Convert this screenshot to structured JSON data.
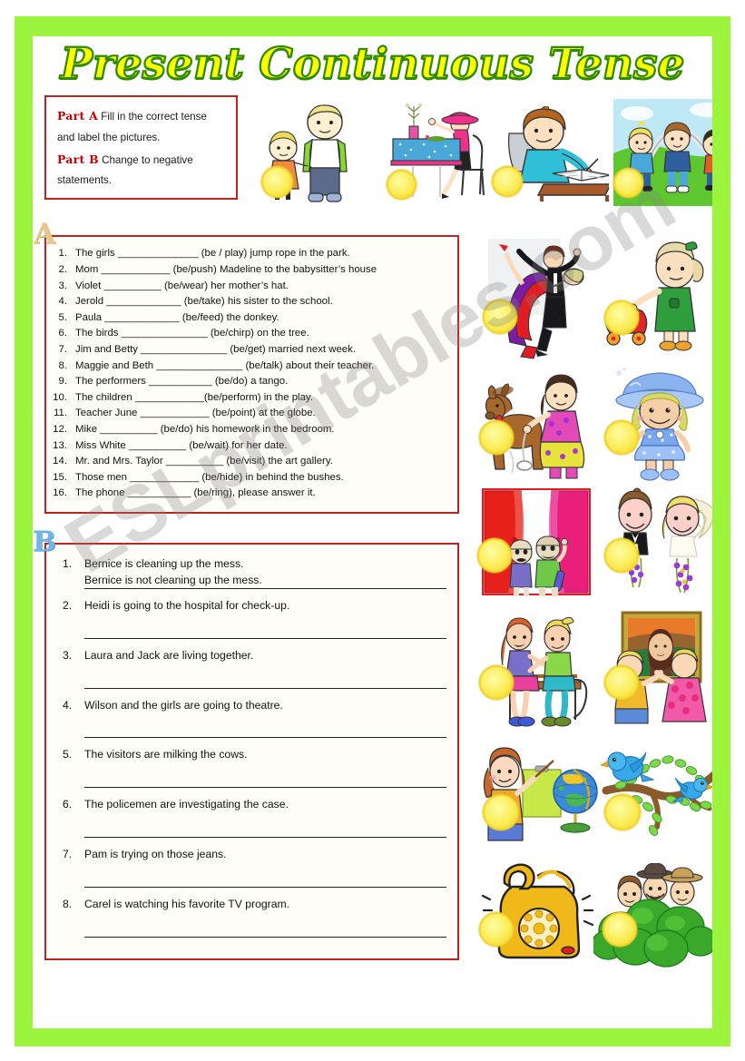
{
  "title": "Present Continuous Tense",
  "watermark": "ESLprintables.com",
  "colors": {
    "frame_green": "#9cf53c",
    "title_yellow": "#ffff00",
    "title_outline_green": "#2e8b00",
    "box_red": "#c0231f",
    "part_label_red": "#cc0000",
    "coin_yellow": "#fbed57"
  },
  "instructions": {
    "part_a_label": "Part A",
    "part_a_text": "Fill in the correct tense and label the pictures.",
    "part_b_label": "Part B",
    "part_b_text": "Change to negative statements."
  },
  "section_a": {
    "badge": "A",
    "items": [
      {
        "num": "1.",
        "text": "The girls ______________ (be / play) jump rope in the park."
      },
      {
        "num": "2.",
        "text": "Mom ____________ (be/push) Madeline to the babysitter’s house"
      },
      {
        "num": "3.",
        "text": "Violet __________ (be/wear) her mother’s hat."
      },
      {
        "num": "4.",
        "text": "Jerold _____________ (be/take) his sister to the school."
      },
      {
        "num": "5.",
        "text": "Paula _____________ (be/feed) the donkey."
      },
      {
        "num": "6.",
        "text": "The birds _______________ (be/chirp) on the tree."
      },
      {
        "num": "7.",
        "text": "Jim and Betty _______________ (be/get) married next week."
      },
      {
        "num": "8.",
        "text": "Maggie and Beth _______________ (be/talk) about their teacher."
      },
      {
        "num": "9.",
        "text": "The performers ___________ (be/do) a tango."
      },
      {
        "num": "10.",
        "text": "The children ____________(be/perform) in the play."
      },
      {
        "num": "11.",
        "text": "Teacher June ____________ (be/point) at the globe."
      },
      {
        "num": "12.",
        "text": "Mike __________ (be/do) his homework in the bedroom."
      },
      {
        "num": "13.",
        "text": "Miss White __________ (be/wait) for her date."
      },
      {
        "num": "14.",
        "text": "Mr. and Mrs. Taylor __________ (be/visit) the art gallery."
      },
      {
        "num": "15.",
        "text": "Those men ____________ (be/hide) in behind the bushes."
      },
      {
        "num": "16.",
        "text": "The phone ___________ (be/ring), please answer it."
      }
    ]
  },
  "section_b": {
    "badge": "B",
    "items": [
      {
        "num": "1.",
        "prompt": "Bernice is cleaning up the mess.",
        "answer": "Bernice is not cleaning up the mess."
      },
      {
        "num": "2.",
        "prompt": "Heidi is going to the hospital for check-up.",
        "answer": ""
      },
      {
        "num": "3.",
        "prompt": "Laura and Jack are living together.",
        "answer": ""
      },
      {
        "num": "4.",
        "prompt": "Wilson and the girls are going to theatre.",
        "answer": ""
      },
      {
        "num": "5.",
        "prompt": "The visitors are milking the cows.",
        "answer": ""
      },
      {
        "num": "6.",
        "prompt": "The policemen are investigating the case.",
        "answer": ""
      },
      {
        "num": "7.",
        "prompt": "Pam is trying on those jeans.",
        "answer": ""
      },
      {
        "num": "8.",
        "prompt": "Carel is watching his favorite TV program.",
        "answer": ""
      }
    ]
  },
  "pictures": {
    "top": [
      {
        "name": "children-holding-hands",
        "label": "two children holding hands"
      },
      {
        "name": "woman-in-pink-hat-at-table",
        "label": "woman wearing a pink hat at a table"
      },
      {
        "name": "boy-writing-at-desk",
        "label": "boy writing in a book at a desk"
      },
      {
        "name": "children-jumping-rope",
        "label": "children jumping rope in the park"
      }
    ],
    "right": [
      {
        "name": "tango-dancers",
        "label": "couple dancing a tango"
      },
      {
        "name": "girl-pushing-stroller",
        "label": "girl pushing a baby stroller"
      },
      {
        "name": "girl-with-donkey",
        "label": "girl feeding a donkey"
      },
      {
        "name": "girl-in-blue-hat",
        "label": "girl wearing a blue hat"
      },
      {
        "name": "theatre-stage-performers",
        "label": "performers on a theatre stage"
      },
      {
        "name": "bride-and-groom",
        "label": "bride and groom getting married"
      },
      {
        "name": "girls-talking-on-bench",
        "label": "two girls talking on a bench"
      },
      {
        "name": "people-viewing-painting",
        "label": "people visiting an art gallery"
      },
      {
        "name": "teacher-pointing-at-globe",
        "label": "teacher pointing at a globe"
      },
      {
        "name": "birds-on-branch",
        "label": "birds chirping on a tree branch"
      },
      {
        "name": "ringing-telephone",
        "label": "ringing telephone"
      },
      {
        "name": "men-hiding-behind-bushes",
        "label": "men hiding behind the bushes"
      }
    ]
  }
}
